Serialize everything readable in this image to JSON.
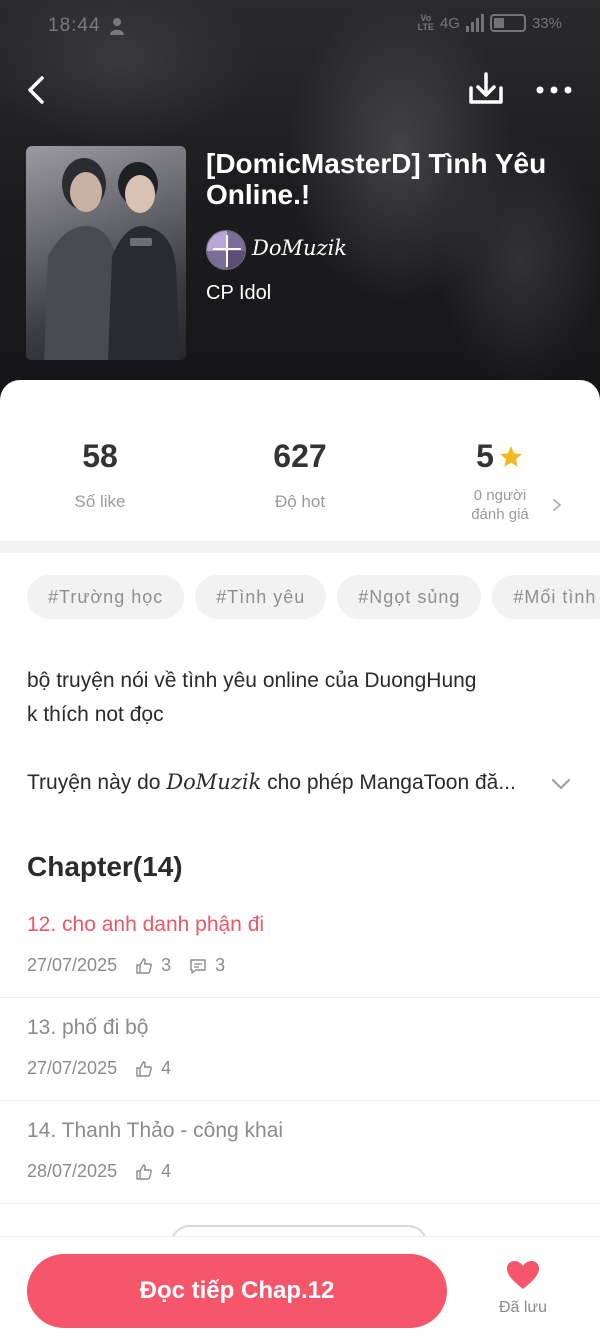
{
  "status_bar": {
    "time": "18:44",
    "network": "4G",
    "battery": "33%"
  },
  "header": {
    "back_icon": "chevron-left-icon",
    "download_icon": "download-icon",
    "more_icon": "more-dots-icon"
  },
  "comic": {
    "title": "[DomicMasterD] Tình Yêu Online.!",
    "author": "DoMuzik",
    "category": "CP Idol"
  },
  "stats": [
    {
      "value": "58",
      "label": "Số like"
    },
    {
      "value": "627",
      "label": "Độ hot"
    },
    {
      "value": "5",
      "label_line1": "0 người",
      "label_line2": "đánh giá"
    }
  ],
  "tags": [
    "#Trường học",
    "#Tình yêu",
    "#Ngọt sủng",
    "#Mối tình"
  ],
  "description": {
    "line1": "bộ truyện nói về tình yêu online của DuongHung",
    "line2": "k thích not đọc",
    "permission_before": "Truyện này do ",
    "permission_author": "DoMuzik",
    "permission_after": " cho phép MangaToon đă..."
  },
  "chapters_heading": "Chapter(14)",
  "chapters": [
    {
      "title": "12. cho anh danh phận đi",
      "date": "27/07/2025",
      "likes": "3",
      "comments": "3",
      "current": true
    },
    {
      "title": "13. phố đi bộ",
      "date": "27/07/2025",
      "likes": "4"
    },
    {
      "title": "14. Thanh Thảo - công khai",
      "date": "28/07/2025",
      "likes": "4"
    }
  ],
  "bottom_bar": {
    "read_button": "Đọc tiếp Chap.12",
    "saved_label": "Đã lưu"
  },
  "colors": {
    "accent": "#f5566a",
    "current_chapter": "#ec5766",
    "star": "#f6b820"
  }
}
